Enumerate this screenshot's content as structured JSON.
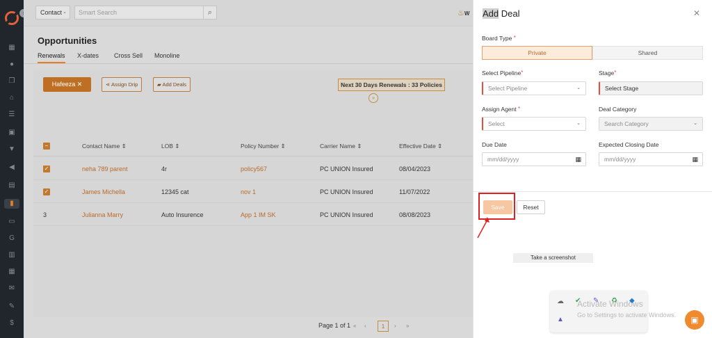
{
  "colors": {
    "accent": "#e67e22",
    "rail": "#20262c",
    "required": "#e74c3c",
    "highlight_box": "#e02020"
  },
  "topbar": {
    "contact_select": "Contact",
    "search_placeholder": "Smart Search",
    "user_initial": "W"
  },
  "page": {
    "title": "Opportunities",
    "tabs": [
      "Renewals",
      "X-dates",
      "Cross Sell",
      "Monoline"
    ],
    "active_tab": "Renewals"
  },
  "toolbar": {
    "filter_chip": "Hafeeza",
    "assign_drip": "Assign Drip",
    "add_deals": "Add Deals",
    "renewals_banner": "Next 30 Days Renewals : 33 Policies"
  },
  "table": {
    "headers": [
      "Contact Name",
      "LOB",
      "Policy Number",
      "Carrier Name",
      "Effective Date"
    ],
    "rows": [
      {
        "contact": "neha 789 parent",
        "lob": "4r",
        "policy": "policy567",
        "carrier": "PC UNION Insured",
        "effective": "08/04/2023"
      },
      {
        "contact": "James Michella",
        "lob": "12345 cat",
        "policy": "nov 1",
        "carrier": "PC UNION Insured",
        "effective": "11/07/2022"
      },
      {
        "index": "3",
        "contact": "Julianna Marry",
        "lob": "Auto Insurence",
        "policy": "App 1 IM SK",
        "carrier": "PC UNION Insured",
        "effective": "08/08/2023"
      }
    ]
  },
  "pagination": {
    "label": "Page 1 of 1",
    "current": "1"
  },
  "drawer": {
    "title_highlight": "Add",
    "title_rest": " Deal",
    "board_type_label": "Board Type",
    "board_options": [
      "Private",
      "Shared"
    ],
    "selected_board": "Private",
    "select_pipeline_label": "Select Pipeline",
    "select_pipeline_placeholder": "Select Pipeline",
    "stage_label": "Stage",
    "stage_value": "Select Stage",
    "assign_agent_label": "Assign Agent",
    "assign_agent_placeholder": "Select",
    "deal_category_label": "Deal Category",
    "deal_category_placeholder": "Search Category",
    "due_date_label": "Due Date",
    "due_date_placeholder": "mm/dd/yyyy",
    "expected_closing_label": "Expected Closing Date",
    "expected_closing_placeholder": "mm/dd/yyyy",
    "save_label": "Save",
    "reset_label": "Reset",
    "screenshot_tip": "Take a screenshot"
  },
  "os_overlay": {
    "watermark_title": "Activate Windows",
    "watermark_sub": "Go to Settings to activate Windows."
  },
  "icons": {
    "search": "search-icon",
    "close": "close-icon",
    "chevron": "chevron-down-icon",
    "calendar": "calendar-icon",
    "chat": "chat-icon"
  }
}
